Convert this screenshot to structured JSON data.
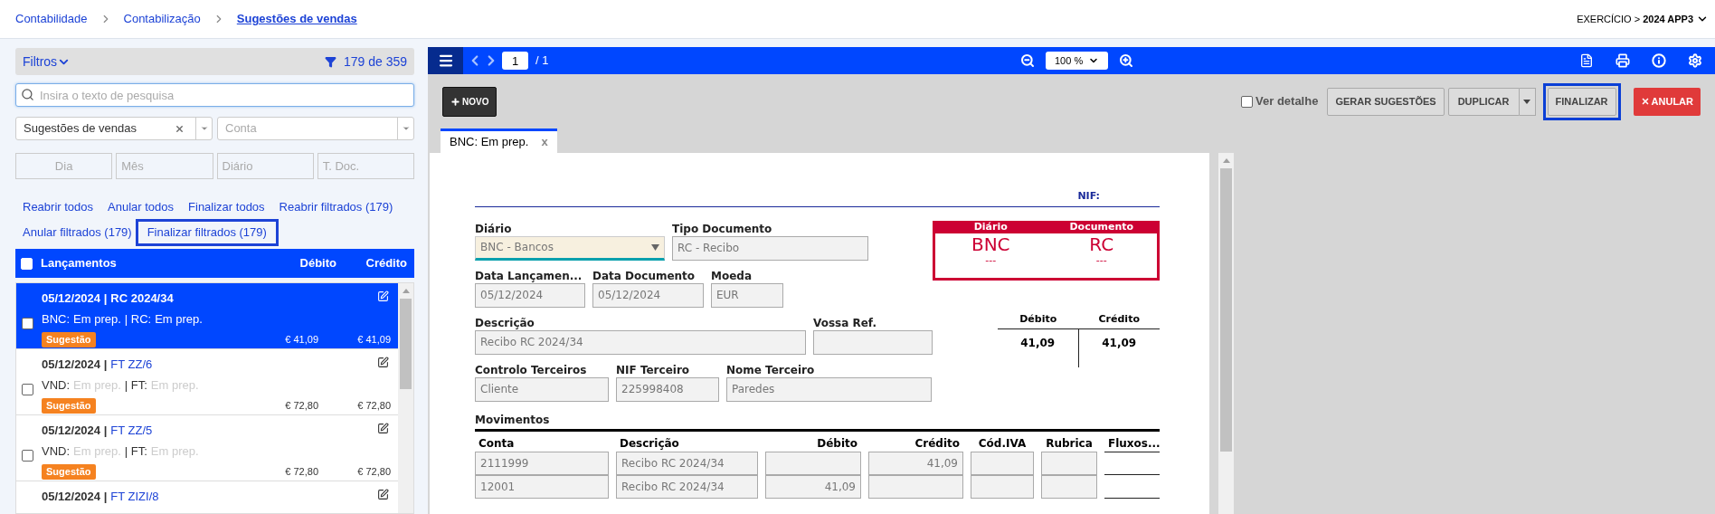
{
  "breadcrumb": [
    {
      "label": "Contabilidade",
      "current": false
    },
    {
      "label": "Contabilização",
      "current": false
    },
    {
      "label": "Sugestões de vendas",
      "current": true
    }
  ],
  "exercise": {
    "label": "EXERCÍCIO >",
    "value": "2024 APP3"
  },
  "filters": {
    "title": "Filtros",
    "count": "179 de 359",
    "search_placeholder": "Insira o texto de pesquisa",
    "type_value": "Sugestões de vendas",
    "account_placeholder": "Conta",
    "fields": [
      {
        "placeholder": "Dia"
      },
      {
        "placeholder": "Mês"
      },
      {
        "placeholder": "Diário"
      },
      {
        "placeholder": "T. Doc."
      }
    ]
  },
  "actions": [
    {
      "label": "Reabrir todos",
      "highlighted": false
    },
    {
      "label": "Anular todos",
      "highlighted": false
    },
    {
      "label": "Finalizar todos",
      "highlighted": false
    },
    {
      "label": "Reabrir filtrados (179)",
      "highlighted": false
    },
    {
      "label": "Anular filtrados (179)",
      "highlighted": false
    },
    {
      "label": "Finalizar filtrados (179)",
      "highlighted": true
    }
  ],
  "list": {
    "all_checked": false,
    "columns": [
      "Lançamentos",
      "Débito",
      "Crédito"
    ],
    "items": [
      {
        "date": "05/12/2024 |",
        "doc": "RC 2024/34",
        "status": [
          {
            "text": "BNC:",
            "muted": false
          },
          {
            "text": "Em prep.",
            "muted": false
          },
          {
            "text": "| RC:",
            "muted": false
          },
          {
            "text": "Em prep.",
            "muted": false
          }
        ],
        "badge": "Sugestão",
        "debit": "€ 41,09",
        "credit": "€ 41,09",
        "selected": true,
        "checked": false
      },
      {
        "date": "05/12/2024 |",
        "doc": "FT ZZ/6",
        "status": [
          {
            "text": "VND:",
            "muted": false
          },
          {
            "text": "Em prep.",
            "muted": true
          },
          {
            "text": "| FT:",
            "muted": false
          },
          {
            "text": "Em prep.",
            "muted": true
          }
        ],
        "badge": "Sugestão",
        "debit": "€ 72,80",
        "credit": "€ 72,80",
        "selected": false,
        "checked": false
      },
      {
        "date": "05/12/2024 |",
        "doc": "FT ZZ/5",
        "status": [
          {
            "text": "VND:",
            "muted": false
          },
          {
            "text": "Em prep.",
            "muted": true
          },
          {
            "text": "| FT:",
            "muted": false
          },
          {
            "text": "Em prep.",
            "muted": true
          }
        ],
        "badge": "Sugestão",
        "debit": "€ 72,80",
        "credit": "€ 72,80",
        "selected": false,
        "checked": false
      },
      {
        "date": "05/12/2024 |",
        "doc": "FT ZIZI/8",
        "selected": false
      }
    ]
  },
  "viewer": {
    "page": "1",
    "pages": "/ 1",
    "zoom": "100 %"
  },
  "toolbar": {
    "new_label": "NOVO",
    "detail": {
      "label": "Ver detalhe",
      "checked": false
    },
    "buttons": [
      {
        "label": "GERAR SUGESTÕES",
        "kind": "default",
        "highlighted": false
      },
      {
        "label": "DUPLICAR",
        "kind": "split",
        "highlighted": false
      },
      {
        "label": "FINALIZAR",
        "kind": "default",
        "highlighted": true
      },
      {
        "label": "ANULAR",
        "kind": "danger",
        "highlighted": false
      }
    ]
  },
  "tabs": [
    {
      "label": "BNC: Em prep.",
      "close": "x",
      "selected": true
    }
  ],
  "document": {
    "nif_label": "NIF:",
    "rows": [
      [
        {
          "label": "Diário",
          "value": "BNC - Bancos",
          "kind": "select"
        },
        {
          "label": "Tipo Documento",
          "value": "RC - Recibo",
          "kind": "text"
        }
      ],
      [
        {
          "label": "Data Lançamen...",
          "value": "05/12/2024",
          "kind": "text"
        },
        {
          "label": "Data Documento",
          "value": "05/12/2024",
          "kind": "text"
        },
        {
          "label": "Moeda",
          "value": "EUR",
          "kind": "text"
        }
      ],
      [
        {
          "label": "Descrição",
          "value": "Recibo RC 2024/34",
          "kind": "text"
        },
        {
          "label": "Vossa Ref.",
          "kind": "text"
        }
      ],
      [
        {
          "label": "Controlo Terceiros",
          "value": "Cliente",
          "kind": "text"
        },
        {
          "label": "NIF Terceiro",
          "value": "225998408",
          "kind": "text"
        },
        {
          "label": "Nome Terceiro",
          "value": "Paredes",
          "kind": "text"
        }
      ]
    ],
    "summary": [
      {
        "header": "Diário",
        "value": "BNC",
        "sub": "---"
      },
      {
        "header": "Documento",
        "value": "RC",
        "sub": "---"
      }
    ],
    "totals": [
      {
        "header": "Débito",
        "value": "41,09"
      },
      {
        "header": "Crédito",
        "value": "41,09"
      }
    ],
    "movements": {
      "title": "Movimentos",
      "columns": [
        "Conta",
        "Descrição",
        "Débito",
        "Crédito",
        "Cód.IVA",
        "Rubrica",
        "Fluxos..."
      ],
      "rows": [
        {
          "conta": "2111999",
          "descricao": "Recibo RC 2024/34",
          "credito": "41,09"
        },
        {
          "conta": "12001",
          "descricao": "Recibo RC 2024/34",
          "debito": "41,09"
        }
      ]
    }
  }
}
